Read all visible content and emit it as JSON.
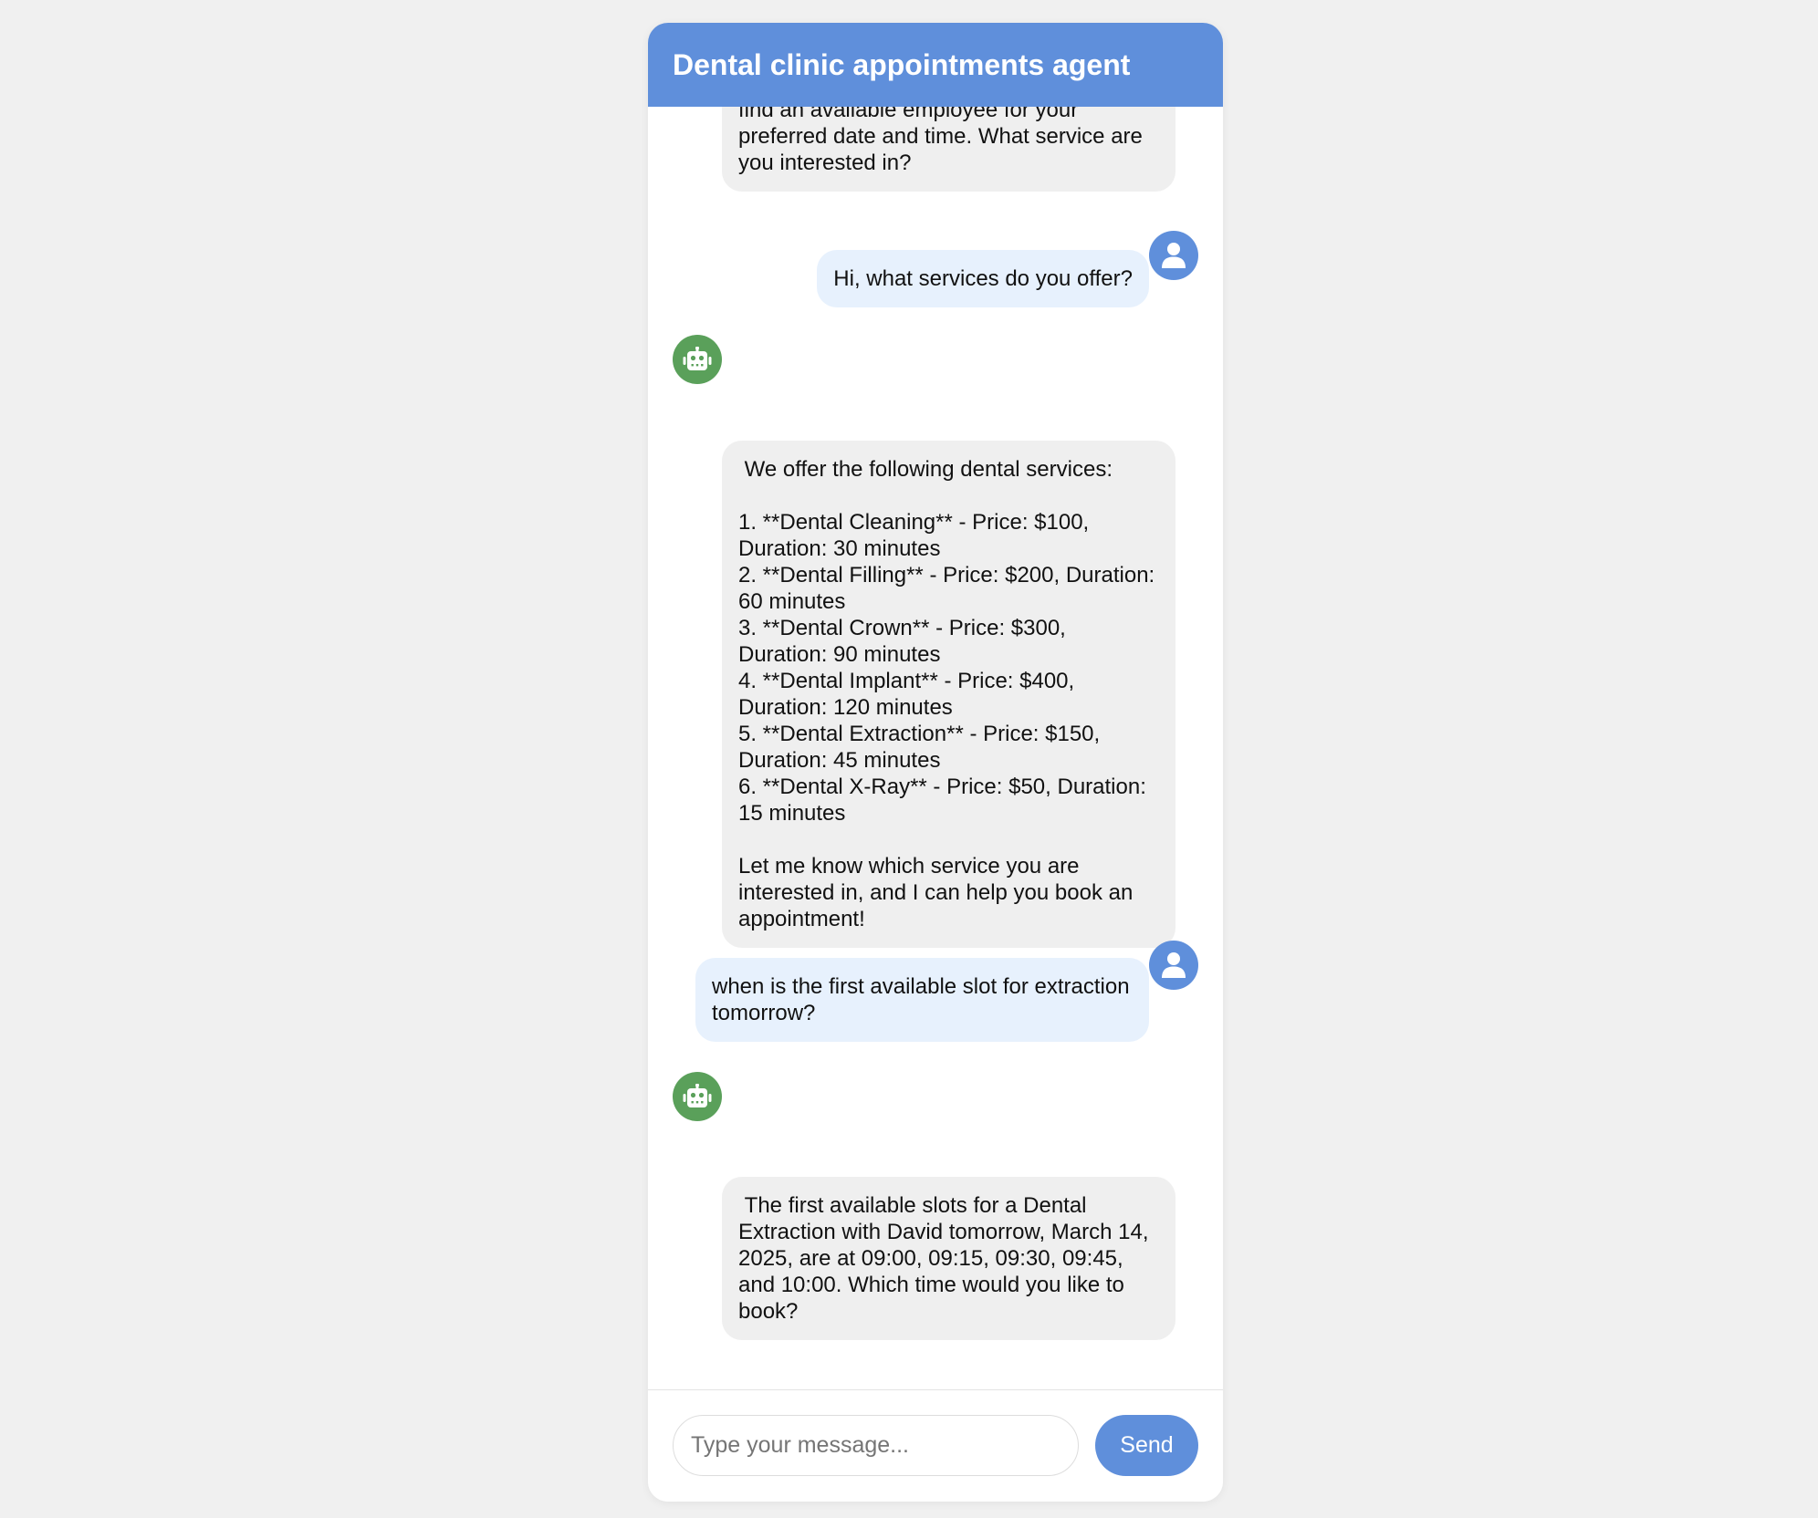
{
  "header": {
    "title": "Dental clinic appointments agent"
  },
  "messages": [
    {
      "role": "bot",
      "text": "from various services, and I can help you find an available employee for your preferred date and time. What service are you interested in?"
    },
    {
      "role": "user",
      "text": "Hi, what services do you offer?"
    },
    {
      "role": "bot",
      "text": " We offer the following dental services:\n\n1. **Dental Cleaning** - Price: $100, Duration: 30 minutes\n2. **Dental Filling** - Price: $200, Duration: 60 minutes\n3. **Dental Crown** - Price: $300, Duration: 90 minutes\n4. **Dental Implant** - Price: $400, Duration: 120 minutes\n5. **Dental Extraction** - Price: $150, Duration: 45 minutes\n6. **Dental X-Ray** - Price: $50, Duration: 15 minutes\n\nLet me know which service you are interested in, and I can help you book an appointment!"
    },
    {
      "role": "user",
      "text": "when is the first available slot for extraction tomorrow?"
    },
    {
      "role": "bot",
      "text": " The first available slots for a Dental Extraction with David tomorrow, March 14, 2025, are at 09:00, 09:15, 09:30, 09:45, and 10:00. Which time would you like to book?"
    }
  ],
  "composer": {
    "placeholder": "Type your message...",
    "value": "",
    "send_label": "Send"
  },
  "colors": {
    "header_bg": "#5f8fdb",
    "user_bubble": "#e7f1fd",
    "bot_bubble": "#efefef",
    "user_avatar": "#5f8fdb",
    "bot_avatar": "#5aa05a",
    "send_button": "#5f8fdb"
  },
  "icons": {
    "user_avatar": "user-icon",
    "bot_avatar": "robot-icon"
  }
}
